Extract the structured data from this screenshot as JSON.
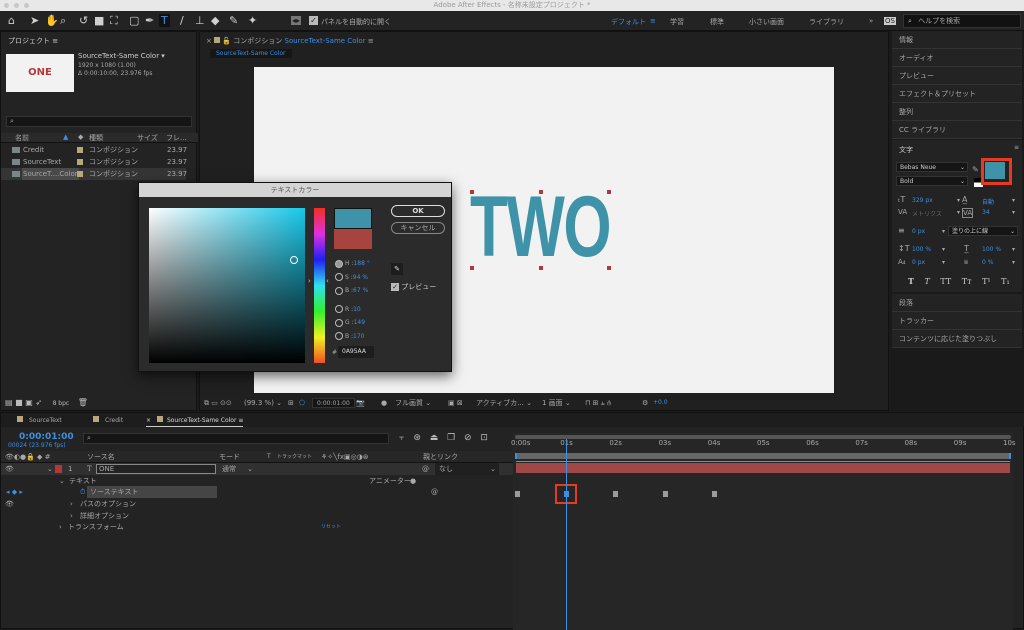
{
  "app": {
    "title": "Adobe After Effects - 名称未設定プロジェクト *"
  },
  "toolbar": {
    "auto_open_label": "パネルを自動的に開く",
    "workspaces": [
      "デフォルト",
      "学習",
      "標準",
      "小さい画面",
      "ライブラリ"
    ],
    "more": "»",
    "search_placeholder": "ヘルプを検索"
  },
  "project": {
    "title": "プロジェクト",
    "thumb_text": "ONE",
    "comp_name": "SourceText-Same Color ▾",
    "comp_size": "1920 x 1080 (1.00)",
    "comp_duration": "Δ 0:00:10:00, 23.976 fps",
    "columns": [
      "名前",
      "種類",
      "サイズ",
      "フレ..."
    ],
    "items": [
      {
        "name": "Credit",
        "type": "コンポジション",
        "fps": "23.97"
      },
      {
        "name": "SourceText",
        "type": "コンポジション",
        "fps": "23.97"
      },
      {
        "name": "SourceT....Color",
        "type": "コンポジション",
        "fps": "23.97"
      }
    ],
    "bpc": "8 bpc"
  },
  "comp": {
    "header": "コンポジション",
    "name": "SourceText-Same Color",
    "tab": "SourceText-Same Color",
    "canvas_text": "TWO",
    "zoom": "(99.3 %)",
    "time": "0:00:01:00",
    "quality": "フル画質",
    "camera": "アクティブカ...",
    "views": "1 画面",
    "exposure": "+0.0"
  },
  "dialog": {
    "title": "テキストカラー",
    "ok": "OK",
    "cancel": "キャンセル",
    "h_label": "H :",
    "h": "188 °",
    "s_label": "S :",
    "s": "94 %",
    "b_label": "B :",
    "b": "67 %",
    "r_label": "R :",
    "r": "10",
    "g_label": "G :",
    "g": "149",
    "bb_label": "B :",
    "bv": "170",
    "hex_label": "#",
    "hex": "0A95AA",
    "preview": "プレビュー",
    "new_color": "#3f93a8",
    "old_color": "#a84440"
  },
  "right": {
    "items_top": [
      "情報",
      "オーディオ",
      "プレビュー",
      "エフェクト＆プリセット",
      "整列",
      "CC ライブラリ"
    ],
    "character": {
      "title": "文字",
      "font": "Bebas Neue",
      "style": "Bold",
      "size": "329 px",
      "leading": "自動",
      "kerning": "メトリクス",
      "tracking": "34",
      "stroke": "0 px",
      "stroke_type": "塗りの上に線",
      "vscale": "100 %",
      "hscale": "100 %",
      "baseline": "0 px",
      "tsume": "0 %",
      "fill_color": "#3f93a8",
      "styles": [
        "T",
        "T",
        "TT",
        "Tт",
        "T¹",
        "T₁"
      ]
    },
    "items_bottom": [
      "段落",
      "トラッカー",
      "コンテンツに応じた塗りつぶし"
    ]
  },
  "timeline": {
    "tabs": [
      "SourceText",
      "Credit",
      "SourceText-Same Color"
    ],
    "timecode": "0:00:01:00",
    "frames": "00024 (23.976 fps)",
    "columns": {
      "source": "ソース名",
      "mode": "モード",
      "t": "T",
      "trkmat": "トラックマット",
      "parent": "親とリンク"
    },
    "layer": {
      "num": "1",
      "name": "ONE",
      "mode": "通常",
      "parent": "なし"
    },
    "props": {
      "text": "テキスト",
      "animator": "アニメーター :",
      "source_text": "ソーステキスト",
      "path": "パスのオプション",
      "more": "詳細オプション",
      "transform": "トランスフォーム",
      "reset": "リセット"
    },
    "ruler": [
      "0:00s",
      "01s",
      "02s",
      "03s",
      "04s",
      "05s",
      "06s",
      "07s",
      "08s",
      "09s",
      "10s"
    ],
    "keyframes_sec": [
      0,
      1,
      2,
      3,
      4
    ],
    "current_sec": 1,
    "duration_sec": 10
  }
}
